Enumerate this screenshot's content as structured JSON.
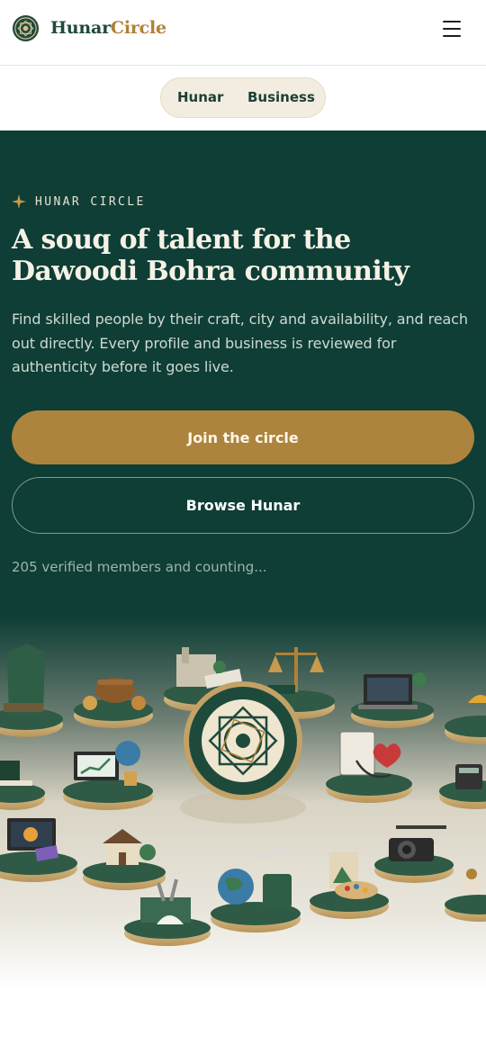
{
  "brand": {
    "name_part1": "Hunar",
    "name_part2": "Circle",
    "logo_icon": "ornamental-medallion-icon",
    "menu_icon": "hamburger-menu-icon"
  },
  "tabs": [
    {
      "label": "Hunar"
    },
    {
      "label": "Business"
    }
  ],
  "hero": {
    "eyebrow": "HUNAR CIRCLE",
    "headline": "A souq of talent for the Dawoodi Bohra community",
    "description": "Find skilled people by their craft, city and availability, and reach out directly. Every profile and business is reviewed for authenticity before it goes live.",
    "primary_cta": "Join the circle",
    "secondary_cta": "Browse Hunar",
    "members_note": "205 verified members and counting..."
  },
  "colors": {
    "hero_bg": "#0e3e35",
    "gold": "#ad843e",
    "brand_green": "#1e4a3c",
    "brand_gold": "#b08136"
  }
}
